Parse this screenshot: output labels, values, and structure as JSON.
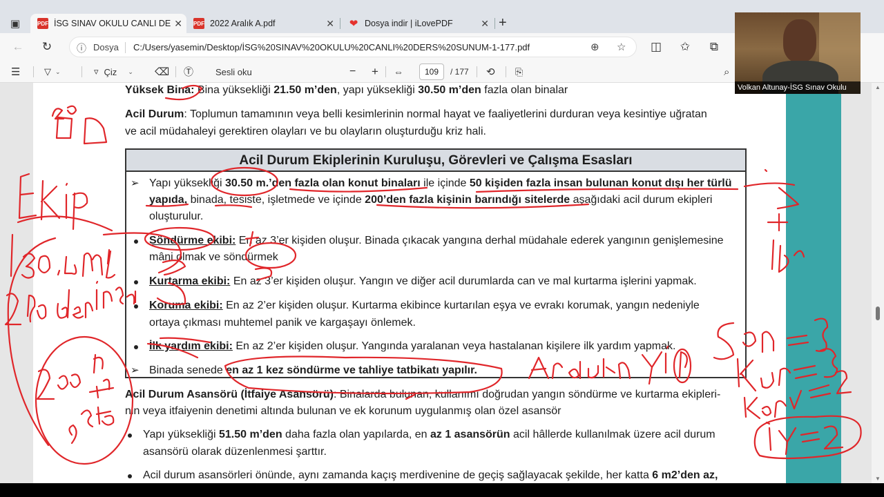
{
  "browser": {
    "tabs": [
      {
        "title": "İSG SINAV OKULU CANLI DERS S",
        "icon": "pdf-icon",
        "active": true
      },
      {
        "title": "2022 Aralık A.pdf",
        "icon": "pdf-icon",
        "active": false
      },
      {
        "title": "Dosya indir | iLovePDF",
        "icon": "ilovepdf-heart-icon",
        "active": false
      }
    ],
    "address": {
      "label": "Dosya",
      "url": "C:/Users/yasemin/Desktop/İSG%20SINAV%20OKULU%20CANLI%20DERS%20SUNUM-1-177.pdf"
    }
  },
  "pdf_toolbar": {
    "draw_label": "Çiz",
    "read_aloud_label": "Sesli oku",
    "page_current": "109",
    "page_total": "/ 177"
  },
  "document": {
    "line1_bold": "Yüksek Bina:",
    "line1_rest_a": " Bina yüksekliği ",
    "line1_v1": "21.50 m’den",
    "line1_rest_b": ", yapı yüksekliği ",
    "line1_v2": "30.50 m’den",
    "line1_rest_c": " fazla olan binalar",
    "acil_bold": "Acil Durum",
    "acil_line1": ": Toplumun tamamının veya belli kesimlerinin normal hayat ve faaliyetlerini durduran veya kesintiye uğratan",
    "acil_line2": "ve acil müdahaleyi gerektiren olayları ve bu olayların oluşturduğu kriz hali.",
    "box_title": "Acil Durum Ekiplerinin Kuruluşu, Görevleri ve Çalışma Esasları",
    "b1_a": "Yapı yüksekliği ",
    "b1_b": "30.50 m.’den fazla olan konut binaları",
    "b1_c": " ile içinde ",
    "b1_d": "50 kişiden fazla insan bulunan konut dışı her türlü",
    "b1_e": "yapıda,",
    "b1_f": " binada, tesiste, işletmede ve içinde ",
    "b1_g": "200’den fazla kişinin barındığı sitelerde",
    "b1_h": " aşağıdaki acil durum ekipleri",
    "b1_i": "oluşturulur.",
    "s_title": "Söndürme ekibi:",
    "s_line1": " En az 3’er kişiden oluşur. Binada çıkacak yangına derhal müdahale ederek yangının genişlemesine",
    "s_line2": "mâni olmak ve söndürmek",
    "k_title": "Kurtarma ekibi:",
    "k_line": " En az 3’er kişiden oluşur. Yangın ve diğer acil durumlarda can ve mal kurtarma işlerini yapmak.",
    "ko_title": "Koruma ekibi:",
    "ko_line1": " En az 2’er kişiden oluşur. Kurtarma ekibince kurtarılan eşya ve evrakı korumak, yangın nedeniyle",
    "ko_line2": "ortaya çıkması muhtemel panik ve kargaşayı önlemek.",
    "i_title": "İlk yardım ekibi:",
    "i_line": " En az 2’er kişiden oluşur. Yangında yaralanan veya hastalanan kişilere ilk yardım yapmak.",
    "t_a": "Binada senede ",
    "t_b": "en az 1 kez söndürme ve tahliye tatbikatı yapılır.",
    "asansor_bold": "Acil Durum Asansörü (İtfaiye Asansörü)",
    "asansor_line1": ": Binalarda bulunan, kullanımı doğrudan yangın söndürme ve kurtarma ekipleri-",
    "asansor_line2": "nin veya itfaiyenin denetimi altında bulunan ve ek korunum uygulanmış olan özel asansör",
    "a1_a": "Yapı yüksekliği ",
    "a1_b": "51.50 m’den",
    "a1_c": " daha fazla olan yapılarda, en ",
    "a1_d": "az 1 asansörün",
    "a1_e": " acil hâllerde kullanılmak üzere acil durum",
    "a1_f": "asansörü olarak düzenlenmesi şarttır.",
    "a2_a": "Acil durum asansörleri önünde, aynı zamanda kaçış merdivenine de geçiş sağlayacak şekilde, her katta ",
    "a2_b": "6 m2’den az,"
  },
  "webcam": {
    "caption": "Volkan Altunay-İSG Sınav Okulu"
  },
  "colors": {
    "annotation_ink": "#e0262a",
    "side_panel": "#3aa6a8"
  }
}
